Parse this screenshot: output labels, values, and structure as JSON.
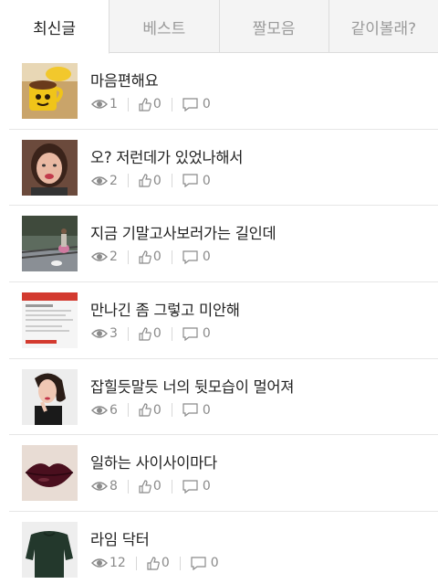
{
  "tabs": [
    {
      "label": "최신글",
      "active": true
    },
    {
      "label": "베스트",
      "active": false
    },
    {
      "label": "짤모음",
      "active": false
    },
    {
      "label": "같이볼래?",
      "active": false
    }
  ],
  "posts": [
    {
      "title": "마음편해요",
      "views": "1",
      "likes": "0",
      "comments": "0",
      "thumb": "cup-photo"
    },
    {
      "title": "오? 저런데가 있었나해서",
      "views": "2",
      "likes": "0",
      "comments": "0",
      "thumb": "person-photo"
    },
    {
      "title": "지금 기말고사보러가는 길인데",
      "views": "2",
      "likes": "0",
      "comments": "0",
      "thumb": "street-photo"
    },
    {
      "title": "만나긴 좀 그렇고 미안해",
      "views": "3",
      "likes": "0",
      "comments": "0",
      "thumb": "screenshot-photo"
    },
    {
      "title": "잡힐듯말듯 너의 뒷모습이 멀어져",
      "views": "6",
      "likes": "0",
      "comments": "0",
      "thumb": "woman-photo"
    },
    {
      "title": "일하는 사이사이마다",
      "views": "8",
      "likes": "0",
      "comments": "0",
      "thumb": "lips-photo"
    },
    {
      "title": "라임 닥터",
      "views": "12",
      "likes": "0",
      "comments": "0",
      "thumb": "sweater-photo"
    }
  ],
  "colors": {
    "accent": "#222222",
    "muted": "#8a8a8a",
    "tab_bg": "#f4f4f4"
  }
}
